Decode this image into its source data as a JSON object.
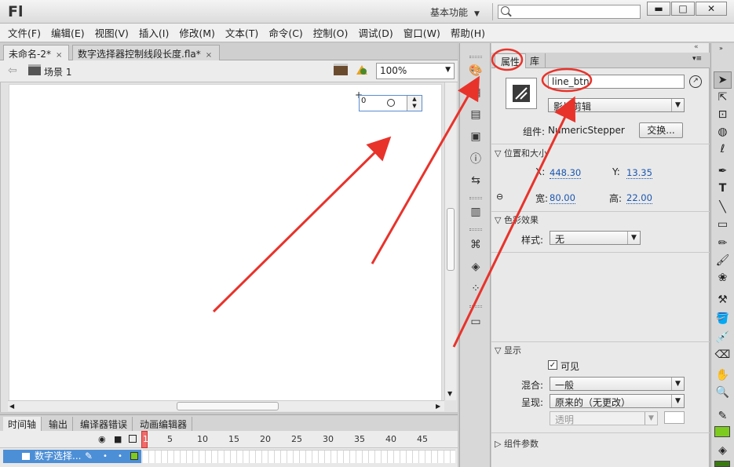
{
  "app": {
    "logo": "Fl",
    "workspace": "基本功能",
    "search_placeholder": ""
  },
  "window_buttons": {
    "minimize": "▬",
    "maximize": "□",
    "close": "✕"
  },
  "menu": [
    "文件(F)",
    "编辑(E)",
    "视图(V)",
    "插入(I)",
    "修改(M)",
    "文本(T)",
    "命令(C)",
    "控制(O)",
    "调试(D)",
    "窗口(W)",
    "帮助(H)"
  ],
  "doc_tabs": [
    {
      "label": "未命名-2*",
      "close": "×"
    },
    {
      "label": "数字选择器控制线段长度.fla*",
      "close": "×"
    }
  ],
  "editbar": {
    "scene": "场景 1",
    "zoom": "100%"
  },
  "stage": {
    "stepper_value": "0"
  },
  "timeline": {
    "tabs": [
      "时间轴",
      "输出",
      "编译器错误",
      "动画编辑器"
    ],
    "frame_numbers": [
      "1",
      "5",
      "10",
      "15",
      "20",
      "25",
      "30",
      "35",
      "40",
      "45"
    ],
    "layer_name": "数字选择..."
  },
  "properties": {
    "tabs": [
      "属性",
      "库"
    ],
    "instance_name": "line_btn",
    "symbol_type": "影片剪辑",
    "component_label": "组件:",
    "component_name": "NumericStepper",
    "swap_button": "交换...",
    "section_position": "位置和大小",
    "x_label": "X:",
    "x_value": "448.30",
    "y_label": "Y:",
    "y_value": "13.35",
    "w_label": "宽:",
    "w_value": "80.00",
    "h_label": "高:",
    "h_value": "22.00",
    "section_color": "色彩效果",
    "style_label": "样式:",
    "style_value": "无",
    "section_display": "显示",
    "visible_label": "可见",
    "blend_label": "混合:",
    "blend_value": "一般",
    "render_label": "呈现:",
    "render_value": "原来的（无更改）",
    "transparent_value": "透明",
    "section_component_params": "组件参数"
  },
  "colors": {
    "accent_red": "#e8332b",
    "layer_blue": "#4d8fd6",
    "link_blue": "#1a56b0",
    "fill_green": "#7ecb20"
  }
}
